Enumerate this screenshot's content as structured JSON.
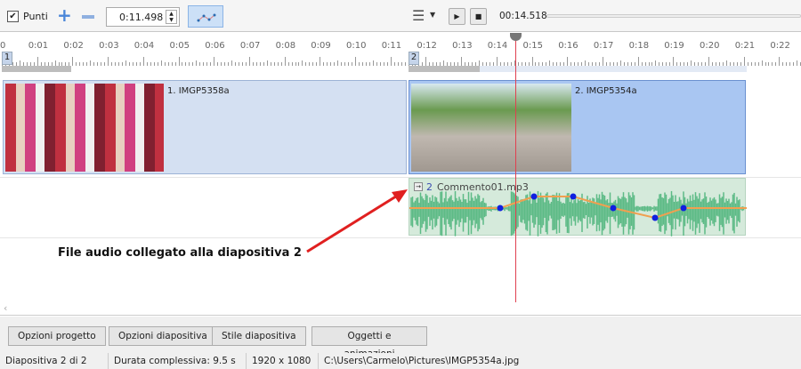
{
  "toolbar": {
    "points_label": "Punti",
    "points_checked": true,
    "time_value": "0:11.498",
    "playback_time": "00:14.518"
  },
  "ruler": {
    "labels": [
      "0",
      "0:01",
      "0:02",
      "0:03",
      "0:04",
      "0:05",
      "0:06",
      "0:07",
      "0:08",
      "0:09",
      "0:10",
      "0:11",
      "0:12",
      "0:13",
      "0:14",
      "0:15",
      "0:16",
      "0:17",
      "0:18",
      "0:19",
      "0:20",
      "0:21",
      "0:22"
    ],
    "slide_markers": [
      "1",
      "2"
    ]
  },
  "slides": [
    {
      "caption": "1. IMGP5358a"
    },
    {
      "caption": "2. IMGP5354a"
    }
  ],
  "audio": {
    "number": "2",
    "file": "Commento01.mp3"
  },
  "annotation": "File audio collegato alla diapositiva 2",
  "buttons": {
    "project": "Opzioni progetto",
    "slide": "Opzioni diapositiva",
    "style": "Stile diapositiva",
    "objects": "Oggetti e animazioni"
  },
  "status": {
    "slide": "Diapositiva 2 di 2",
    "duration": "Durata complessiva: 9.5 s",
    "resolution": "1920 x 1080",
    "path": "C:\\Users\\Carmelo\\Pictures\\IMGP5354a.jpg"
  },
  "colors": {
    "cursor": "#e04050",
    "waveform": "#5dbb86",
    "envelope": "#f0a050",
    "point": "#1020e0"
  }
}
